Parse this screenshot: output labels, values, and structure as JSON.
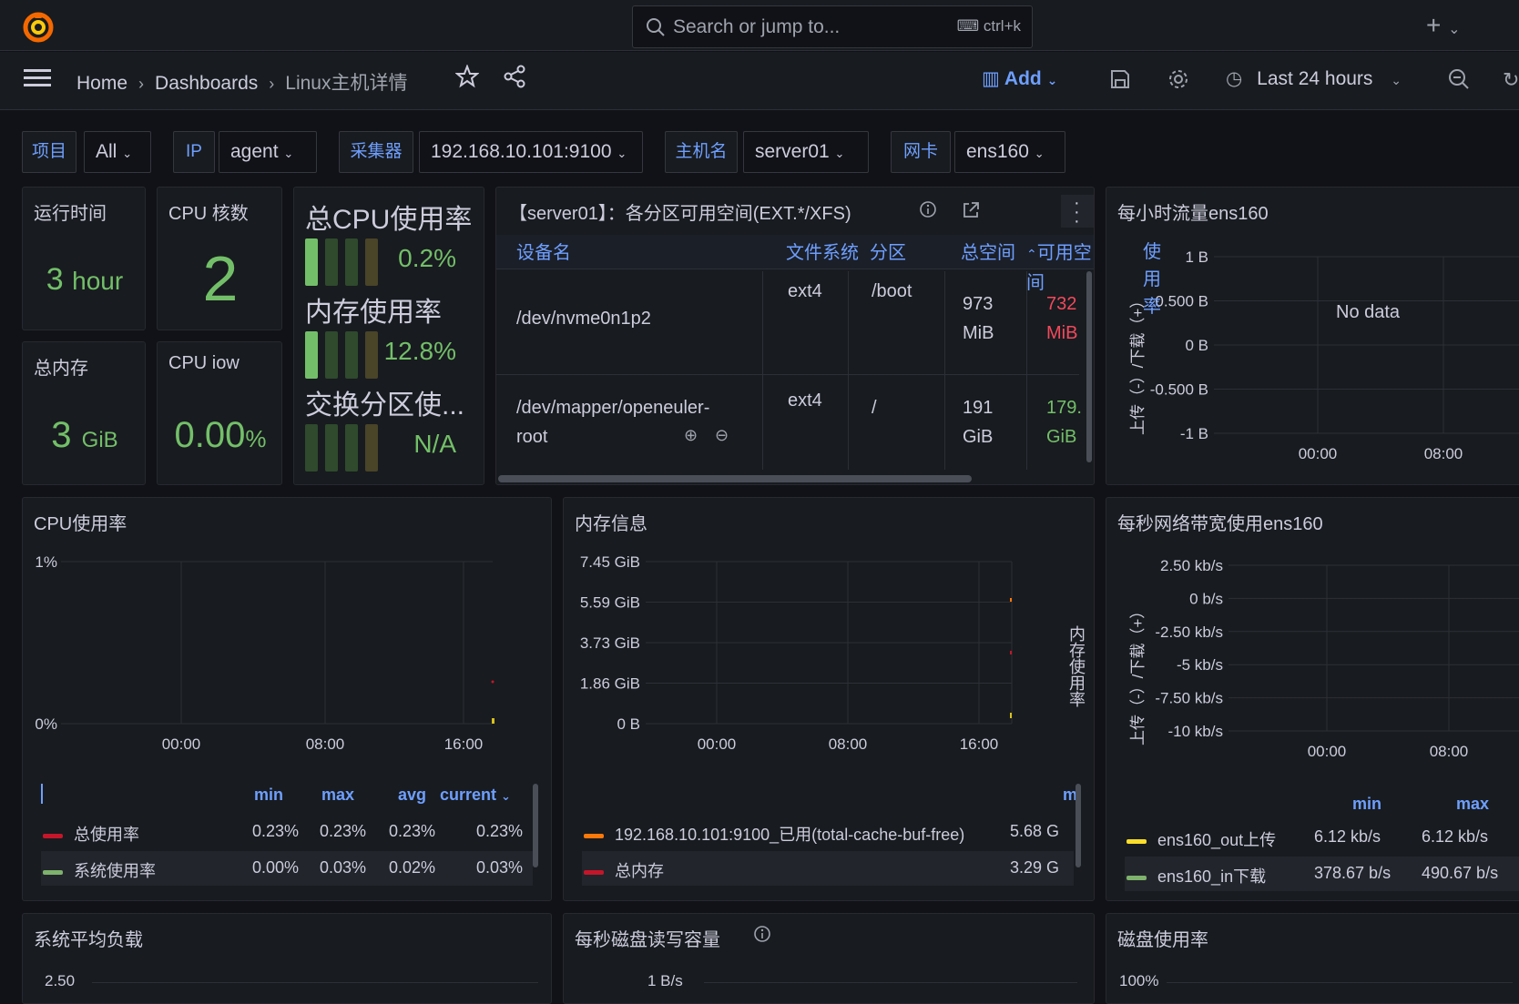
{
  "topbar": {
    "search_placeholder": "Search or jump to...",
    "shortcut": "ctrl+k"
  },
  "breadcrumb": {
    "home": "Home",
    "dashboards": "Dashboards",
    "current": "Linux主机详情"
  },
  "toolbar": {
    "add_label": "Add",
    "time_range": "Last 24 hours"
  },
  "variables": [
    {
      "label": "项目",
      "value": "All"
    },
    {
      "label": "IP",
      "value": "agent"
    },
    {
      "label": "采集器",
      "value": "192.168.10.101:9100"
    },
    {
      "label": "主机名",
      "value": "server01"
    },
    {
      "label": "网卡",
      "value": "ens160"
    }
  ],
  "stats": {
    "uptime": {
      "title": "运行时间",
      "value": "3",
      "unit": "hour"
    },
    "cpu_cores": {
      "title": "CPU 核数",
      "value": "2"
    },
    "total_mem": {
      "title": "总内存",
      "value": "3",
      "unit": "GiB"
    },
    "cpu_iowait": {
      "title": "CPU iow",
      "value": "0.00",
      "unit": "%"
    }
  },
  "gauges": [
    {
      "title": "总CPU使用率",
      "value": "0.2%",
      "fraction": 0.002
    },
    {
      "title": "内存使用率",
      "value": "12.8%",
      "fraction": 0.128
    },
    {
      "title": "交换分区使...",
      "value": "N/A",
      "fraction": 0
    }
  ],
  "disk_table": {
    "title": "【server01】：各分区可用空间(EXT.*/XFS)",
    "headers": [
      "设备名",
      "文件系统",
      "分区",
      "总空间",
      "可用空间"
    ],
    "rows": [
      {
        "device": "/dev/nvme0n1p2",
        "fs": "ext4",
        "mount": "/boot",
        "total_a": "973",
        "total_b": "MiB",
        "avail_a": "732",
        "avail_b": "MiB",
        "avail_color": "#f2495c"
      },
      {
        "device_a": "/dev/mapper/openeuler-",
        "device_b": "root",
        "fs": "ext4",
        "mount": "/",
        "total_a": "191",
        "total_b": "GiB",
        "avail_a": "179.",
        "avail_b": "GiB",
        "avail_color": "#73bf69"
      }
    ]
  },
  "traffic_hour": {
    "title": "每小时流量ens160",
    "y_ticks": [
      "1 B",
      "0.500 B",
      "0 B",
      "-0.500 B",
      "-1 B"
    ],
    "x_ticks": [
      "00:00",
      "08:00"
    ],
    "y_label": "上传（-）/下载（+）",
    "y2_label": "使用率",
    "no_data": "No data"
  },
  "cpu_usage": {
    "title": "CPU使用率",
    "y_ticks": [
      "1%",
      "0%"
    ],
    "x_ticks": [
      "00:00",
      "08:00",
      "16:00"
    ],
    "legend_headers": [
      "min",
      "max",
      "avg",
      "current"
    ],
    "legend": [
      {
        "name": "总使用率",
        "color": "#c4162a",
        "min": "0.23%",
        "max": "0.23%",
        "avg": "0.23%",
        "current": "0.23%"
      },
      {
        "name": "系统使用率",
        "color": "#7eb26d",
        "min": "0.00%",
        "max": "0.03%",
        "avg": "0.02%",
        "current": "0.03%"
      }
    ]
  },
  "mem_info": {
    "title": "内存信息",
    "y_ticks": [
      "7.45 GiB",
      "5.59 GiB",
      "3.73 GiB",
      "1.86 GiB",
      "0 B"
    ],
    "x_ticks": [
      "00:00",
      "08:00",
      "16:00"
    ],
    "y2_label": "内存使用率",
    "legend_head": "mi",
    "legend": [
      {
        "name": "192.168.10.101:9100_已用(total-cache-buf-free)",
        "color": "#ff780a",
        "value": "5.68 G"
      },
      {
        "name": "总内存",
        "color": "#c4162a",
        "value": "3.29 G"
      }
    ]
  },
  "net_bandwidth": {
    "title": "每秒网络带宽使用ens160",
    "y_ticks": [
      "2.50 kb/s",
      "0 b/s",
      "-2.50 kb/s",
      "-5 kb/s",
      "-7.50 kb/s",
      "-10 kb/s"
    ],
    "x_ticks": [
      "00:00",
      "08:00"
    ],
    "y_label": "上传（-）/下载（+）",
    "legend_headers": [
      "min",
      "max"
    ],
    "legend": [
      {
        "name": "ens160_out上传",
        "color": "#fade2a",
        "min": "6.12 kb/s",
        "max": "6.12 kb/s"
      },
      {
        "name": "ens160_in下载",
        "color": "#7eb26d",
        "min": "378.67 b/s",
        "max": "490.67 b/s"
      }
    ]
  },
  "bottom_panels": [
    {
      "title": "系统平均负载",
      "first_tick": "2.50"
    },
    {
      "title": "每秒磁盘读写容量",
      "first_tick": "1 B/s"
    },
    {
      "title": "磁盘使用率",
      "first_tick": "100%"
    }
  ]
}
